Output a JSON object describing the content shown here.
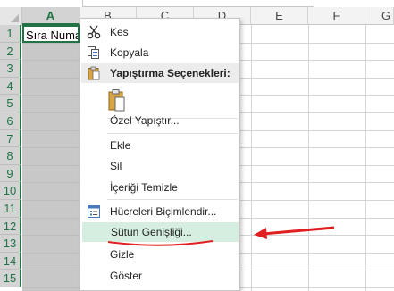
{
  "columns": [
    "A",
    "B",
    "C",
    "D",
    "E",
    "F",
    "G"
  ],
  "rows": [
    "1",
    "2",
    "3",
    "4",
    "5",
    "6",
    "7",
    "8",
    "9",
    "10",
    "11",
    "12",
    "13",
    "14",
    "15"
  ],
  "cell_a1": "Sıra Numa",
  "menu": {
    "cut": "Kes",
    "copy": "Kopyala",
    "paste_options": "Yapıştırma Seçenekleri:",
    "paste_special": "Özel Yapıştır...",
    "insert": "Ekle",
    "delete": "Sil",
    "clear_contents": "İçeriği Temizle",
    "format_cells": "Hücreleri Biçimlendir...",
    "column_width": "Sütun Genişliği...",
    "hide": "Gizle",
    "unhide": "Göster"
  },
  "colors": {
    "accent_green": "#217346",
    "highlight": "#d5eedf",
    "annotation_red": "#e02020"
  },
  "icons": [
    "scissors-icon",
    "copy-icon",
    "clipboard-icon",
    "format-cells-icon"
  ]
}
